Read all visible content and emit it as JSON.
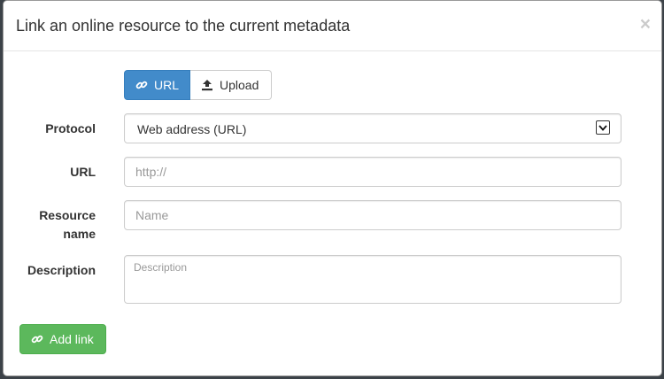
{
  "modal": {
    "title": "Link an online resource to the current metadata",
    "close_symbol": "×"
  },
  "mode_toggle": {
    "url_label": "URL",
    "url_icon": "link-icon",
    "upload_label": "Upload",
    "upload_icon": "upload-icon",
    "active": "URL",
    "active_color": "#428bca"
  },
  "form": {
    "protocol": {
      "label": "Protocol",
      "value": "Web address (URL)"
    },
    "url": {
      "label": "URL",
      "placeholder": "http://"
    },
    "resource_name": {
      "label_line1": "Resource",
      "label_line2": "name",
      "placeholder": "Name"
    },
    "description": {
      "label": "Description",
      "placeholder": "Description"
    }
  },
  "footer": {
    "add_link_label": "Add link",
    "add_link_icon": "link-icon",
    "add_link_color": "#5cb85c"
  }
}
